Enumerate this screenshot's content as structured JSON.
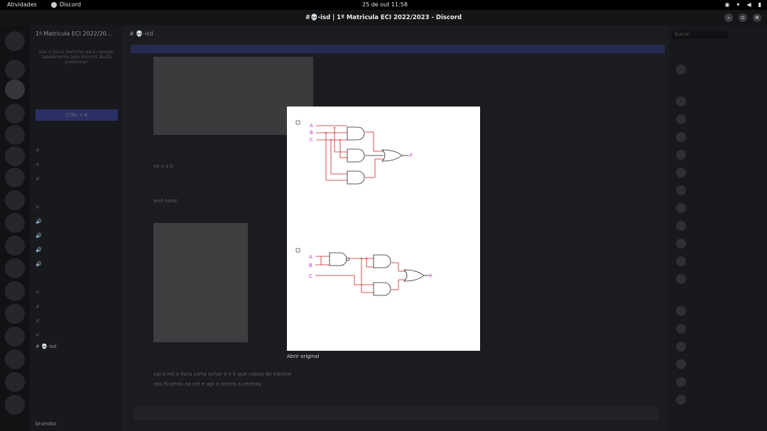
{
  "os": {
    "activities": "Atividades",
    "app_name": "Discord",
    "clock": "25 de out  11:58"
  },
  "window": {
    "title": "#💀-isd | 1º Matricula ECI 2022/2023 - Discord"
  },
  "discord": {
    "server_name": "1º Matricula ECI 2022/20...",
    "channel_name": "💀-isd",
    "quick_switcher_text": "Use o Quick Switcher para navegar rapidamente pelo Discord. Basta pressionar:",
    "quick_switcher_shortcut": "CTRL + K",
    "active_channel": "💀-isd",
    "username": "brunobo",
    "search_placeholder": "Buscar",
    "messages": [
      "yo o a b",
      "and nand",
      "vai o nel e faria corta achar o n é que cabea do mesmo",
      "nos ficamos na nel e agr n temos a certeza"
    ]
  },
  "viewer": {
    "open_original": "Abrir original",
    "circuit1_inputs": [
      "A",
      "B",
      "C"
    ],
    "circuit1_output": "F",
    "circuit2_inputs": [
      "A",
      "B",
      "C"
    ],
    "circuit2_output": "F"
  },
  "colors": {
    "wire_red": "#cc2222",
    "label_magenta": "#cc33cc"
  }
}
